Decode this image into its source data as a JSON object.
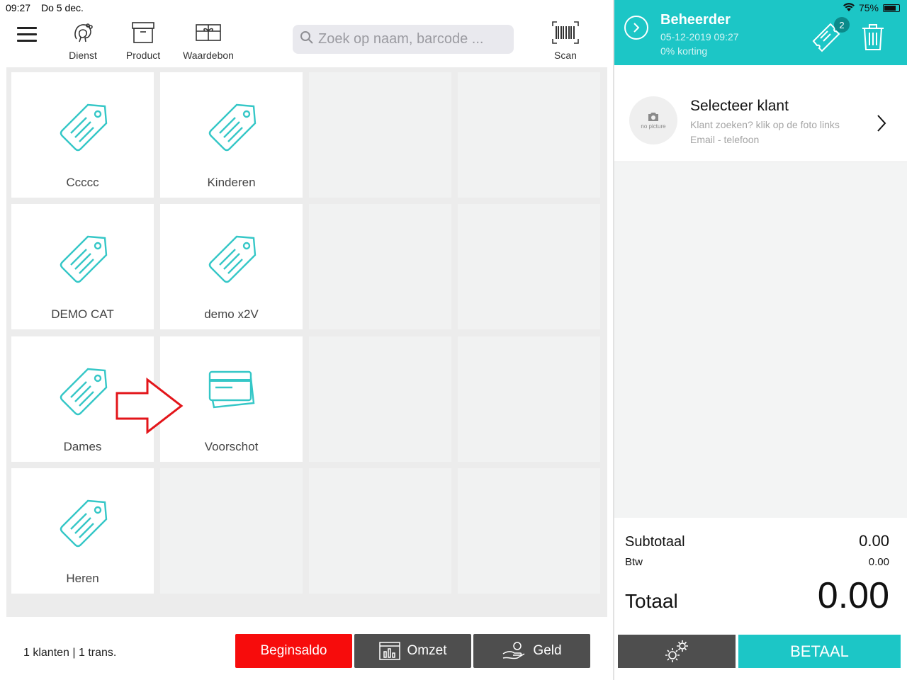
{
  "status_bar": {
    "time": "09:27",
    "date": "Do 5 dec.",
    "battery": "75%"
  },
  "toolbar": {
    "menu_icon": "hamburger-menu-icon",
    "items": [
      {
        "label": "Dienst",
        "icon": "hairdresser-icon"
      },
      {
        "label": "Product",
        "icon": "box-icon"
      },
      {
        "label": "Waardebon",
        "icon": "gift-voucher-icon"
      }
    ],
    "search_placeholder": "Zoek op naam, barcode ...",
    "scan_label": "Scan"
  },
  "categories": [
    {
      "label": "Ccccc",
      "icon": "price-tag-icon"
    },
    {
      "label": "Kinderen",
      "icon": "price-tag-icon"
    },
    {
      "label": "DEMO CAT",
      "icon": "price-tag-icon"
    },
    {
      "label": "demo x2V",
      "icon": "price-tag-icon"
    },
    {
      "label": "Dames",
      "icon": "price-tag-icon"
    },
    {
      "label": "Voorschot",
      "icon": "credit-card-icon"
    },
    {
      "label": "Heren",
      "icon": "price-tag-icon"
    }
  ],
  "annotation": {
    "icon": "red-arrow-right-icon",
    "color": "#e3151a"
  },
  "footer": {
    "counts": "1 klanten | 1 trans.",
    "begin_label": "Beginsaldo",
    "omzet_label": "Omzet",
    "geld_label": "Geld"
  },
  "cart": {
    "user": "Beheerder",
    "datetime": "05-12-2019 09:27",
    "discount": "0% korting",
    "ticket_badge": "2",
    "customer": {
      "title": "Selecteer klant",
      "hint": "Klant zoeken? klik op de foto links",
      "contact": "Email - telefoon",
      "avatar_text": "no picture"
    },
    "subtotal_label": "Subtotaal",
    "subtotal_value": "0.00",
    "btw_label": "Btw",
    "btw_value": "0.00",
    "total_label": "Totaal",
    "total_value": "0.00",
    "pay_label": "BETAAL"
  },
  "colors": {
    "accent": "#1cc6c6",
    "danger": "#f70c0c",
    "dark_button": "#4e4e4e"
  }
}
